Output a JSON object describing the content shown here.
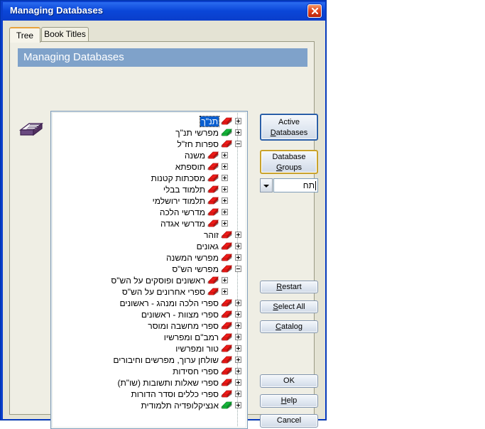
{
  "window": {
    "title": "Managing Databases",
    "close_icon": "close-icon"
  },
  "tabs": [
    {
      "label": "Tree",
      "active": true
    },
    {
      "label": "Book Titles",
      "active": false
    }
  ],
  "header_band": {
    "text": "Managing Databases",
    "color": "#7fa2ca"
  },
  "left_icon": "open-book-icon",
  "tree": {
    "selection_color": "#0a5fd0",
    "items": [
      {
        "label": "תנ\"ך",
        "level": 0,
        "toggle": "expand",
        "book": "red",
        "selected": true
      },
      {
        "label": "מפרשי תנ\"ך",
        "level": 0,
        "toggle": "expand",
        "book": "green",
        "selected": false
      },
      {
        "label": "ספרות חז\"ל",
        "level": 0,
        "toggle": "collapse",
        "book": "red",
        "selected": false
      },
      {
        "label": "משנה",
        "level": 1,
        "toggle": "expand",
        "book": "red",
        "selected": false
      },
      {
        "label": "תוספתא",
        "level": 1,
        "toggle": "expand",
        "book": "red",
        "selected": false
      },
      {
        "label": "מסכתות קטנות",
        "level": 1,
        "toggle": "expand",
        "book": "red",
        "selected": false
      },
      {
        "label": "תלמוד בבלי",
        "level": 1,
        "toggle": "expand",
        "book": "red",
        "selected": false
      },
      {
        "label": "תלמוד ירושלמי",
        "level": 1,
        "toggle": "expand",
        "book": "red",
        "selected": false
      },
      {
        "label": "מדרשי הלכה",
        "level": 1,
        "toggle": "expand",
        "book": "red",
        "selected": false
      },
      {
        "label": "מדרשי אגדה",
        "level": 1,
        "toggle": "expand",
        "book": "red",
        "selected": false
      },
      {
        "label": "זוהר",
        "level": 0,
        "toggle": "expand",
        "book": "red",
        "selected": false
      },
      {
        "label": "גאונים",
        "level": 0,
        "toggle": "expand",
        "book": "red",
        "selected": false
      },
      {
        "label": "מפרשי המשנה",
        "level": 0,
        "toggle": "expand",
        "book": "red",
        "selected": false
      },
      {
        "label": "מפרשי הש\"ס",
        "level": 0,
        "toggle": "collapse",
        "book": "red",
        "selected": false
      },
      {
        "label": "ראשונים ופוסקים על הש\"ס",
        "level": 1,
        "toggle": "expand",
        "book": "red",
        "selected": false
      },
      {
        "label": "ספרי אחרונים על הש\"ס",
        "level": 1,
        "toggle": "expand",
        "book": "red",
        "selected": false
      },
      {
        "label": "ספרי הלכה ומנהג - ראשונים",
        "level": 0,
        "toggle": "expand",
        "book": "red",
        "selected": false
      },
      {
        "label": "ספרי מצוות - ראשונים",
        "level": 0,
        "toggle": "expand",
        "book": "red",
        "selected": false
      },
      {
        "label": "ספרי מחשבה ומוסר",
        "level": 0,
        "toggle": "expand",
        "book": "red",
        "selected": false
      },
      {
        "label": "רמב\"ם ומפרשיו",
        "level": 0,
        "toggle": "expand",
        "book": "red",
        "selected": false
      },
      {
        "label": "טור ומפרשיו",
        "level": 0,
        "toggle": "expand",
        "book": "red",
        "selected": false
      },
      {
        "label": "שולחן ערוך, מפרשים וחיבורים",
        "level": 0,
        "toggle": "expand",
        "book": "red",
        "selected": false
      },
      {
        "label": "ספרי חסידות",
        "level": 0,
        "toggle": "expand",
        "book": "red",
        "selected": false
      },
      {
        "label": "ספרי שאלות ותשובות (שו\"ת)",
        "level": 0,
        "toggle": "expand",
        "book": "red",
        "selected": false
      },
      {
        "label": "ספרי כללים וסדר הדורות",
        "level": 0,
        "toggle": "expand",
        "book": "red",
        "selected": false
      },
      {
        "label": "אנציקלופדיה תלמודית",
        "level": 0,
        "toggle": "expand",
        "book": "green",
        "selected": false
      }
    ]
  },
  "controls": {
    "active_databases": {
      "line1": "Active",
      "line2_pre": "",
      "line2_key": "D",
      "line2_post": "atabases",
      "accent": "#2a5fa8"
    },
    "database_groups": {
      "line1": "Database",
      "line2_pre": "",
      "line2_key": "G",
      "line2_post": "roups",
      "accent": "#c9a22b"
    },
    "combo": {
      "value": "תח",
      "arrow_icon": "chevron-down-icon"
    },
    "restart": {
      "key": "R",
      "rest": "estart"
    },
    "select_all": {
      "key": "S",
      "rest": "elect All"
    },
    "catalog": {
      "key": "C",
      "rest": "atalog"
    },
    "ok": {
      "label": "OK"
    },
    "help": {
      "key": "H",
      "rest": "elp"
    },
    "cancel": {
      "label": "Cancel"
    }
  }
}
